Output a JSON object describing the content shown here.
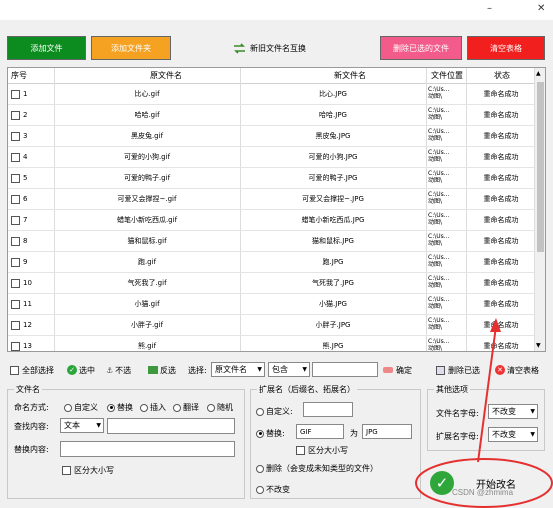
{
  "window": {
    "minimize": "–",
    "close": "✕"
  },
  "toolbar": {
    "add_file": "添加文件",
    "add_folder": "添加文件夹",
    "swap": "新旧文件名互换",
    "delete_selected": "删除已选的文件",
    "clear_table": "清空表格"
  },
  "colors": {
    "green": "#0c8c1f",
    "orange": "#f5a121",
    "pink": "#f35c8a",
    "red": "#f21f1f",
    "annotation": "#e53030"
  },
  "table": {
    "headers": [
      "序号",
      "原文件名",
      "新文件名",
      "文件位置",
      "状态"
    ],
    "rows": [
      {
        "num": "1",
        "old": "比心.gif",
        "new": "比心.JPG",
        "loc1": "C:\\Us...",
        "loc2": "动图\\",
        "status": "重命名成功"
      },
      {
        "num": "2",
        "old": "哈哈.gif",
        "new": "哈哈.JPG",
        "loc1": "C:\\Us...",
        "loc2": "动图\\",
        "status": "重命名成功"
      },
      {
        "num": "3",
        "old": "黑皮兔.gif",
        "new": "黑皮兔.JPG",
        "loc1": "C:\\Us...",
        "loc2": "动图\\",
        "status": "重命名成功"
      },
      {
        "num": "4",
        "old": "可爱的小狗.gif",
        "new": "可爱的小狗.JPG",
        "loc1": "C:\\Us...",
        "loc2": "动图\\",
        "status": "重命名成功"
      },
      {
        "num": "5",
        "old": "可爱的鸭子.gif",
        "new": "可爱的鸭子.JPG",
        "loc1": "C:\\Us...",
        "loc2": "动图\\",
        "status": "重命名成功"
      },
      {
        "num": "6",
        "old": "可爱又会撑捏~.gif",
        "new": "可爱又会撑捏~.JPG",
        "loc1": "C:\\Us...",
        "loc2": "动图\\",
        "status": "重命名成功"
      },
      {
        "num": "7",
        "old": "蜡笔小新吃西瓜.gif",
        "new": "蜡笔小新吃西瓜.JPG",
        "loc1": "C:\\Us...",
        "loc2": "动图\\",
        "status": "重命名成功"
      },
      {
        "num": "8",
        "old": "猫和鼠标.gif",
        "new": "猫和鼠标.JPG",
        "loc1": "C:\\Us...",
        "loc2": "动图\\",
        "status": "重命名成功"
      },
      {
        "num": "9",
        "old": "跑.gif",
        "new": "跑.JPG",
        "loc1": "C:\\Us...",
        "loc2": "动图\\",
        "status": "重命名成功"
      },
      {
        "num": "10",
        "old": "气死我了.gif",
        "new": "气死我了.JPG",
        "loc1": "C:\\Us...",
        "loc2": "动图\\",
        "status": "重命名成功"
      },
      {
        "num": "11",
        "old": "小猫.gif",
        "new": "小猫.JPG",
        "loc1": "C:\\Us...",
        "loc2": "动图\\",
        "status": "重命名成功"
      },
      {
        "num": "12",
        "old": "小胖子.gif",
        "new": "小胖子.JPG",
        "loc1": "C:\\Us...",
        "loc2": "动图\\",
        "status": "重命名成功"
      },
      {
        "num": "13",
        "old": "熊.gif",
        "new": "熊.JPG",
        "loc1": "C:\\Us...",
        "loc2": "动图\\",
        "status": "重命名成功"
      }
    ]
  },
  "selectbar": {
    "select_all": "全部选择",
    "selected": "选中",
    "unselect": "不选",
    "invert": "反选",
    "choose_label": "选择:",
    "field_value": "原文件名",
    "match_value": "包含",
    "confirm": "确定",
    "delete_selected": "删除已选",
    "clear_table": "清空表格"
  },
  "filename_group": {
    "title": "文件名",
    "mode_label": "命名方式:",
    "modes": [
      "自定义",
      "替换",
      "插入",
      "翻译",
      "随机"
    ],
    "find_label": "查找内容:",
    "find_type": "文本",
    "replace_label": "替换内容:",
    "case_label": "区分大小写"
  },
  "ext_group": {
    "title": "扩展名（后缀名、拓展名）",
    "custom_label": "自定义:",
    "replace_label": "替换:",
    "from_value": "GIF",
    "to_label": "为",
    "to_value": "JPG",
    "case_label": "区分大小写",
    "delete_label": "删除（会变成未知类型的文件）",
    "nochange_label": "不改变"
  },
  "other_group": {
    "title": "其他选项",
    "name_case_label": "文件名字母:",
    "name_case_value": "不改变",
    "ext_case_label": "扩展名字母:",
    "ext_case_value": "不改变"
  },
  "start_button": "开始改名",
  "watermark": "CSDN @zhmima"
}
